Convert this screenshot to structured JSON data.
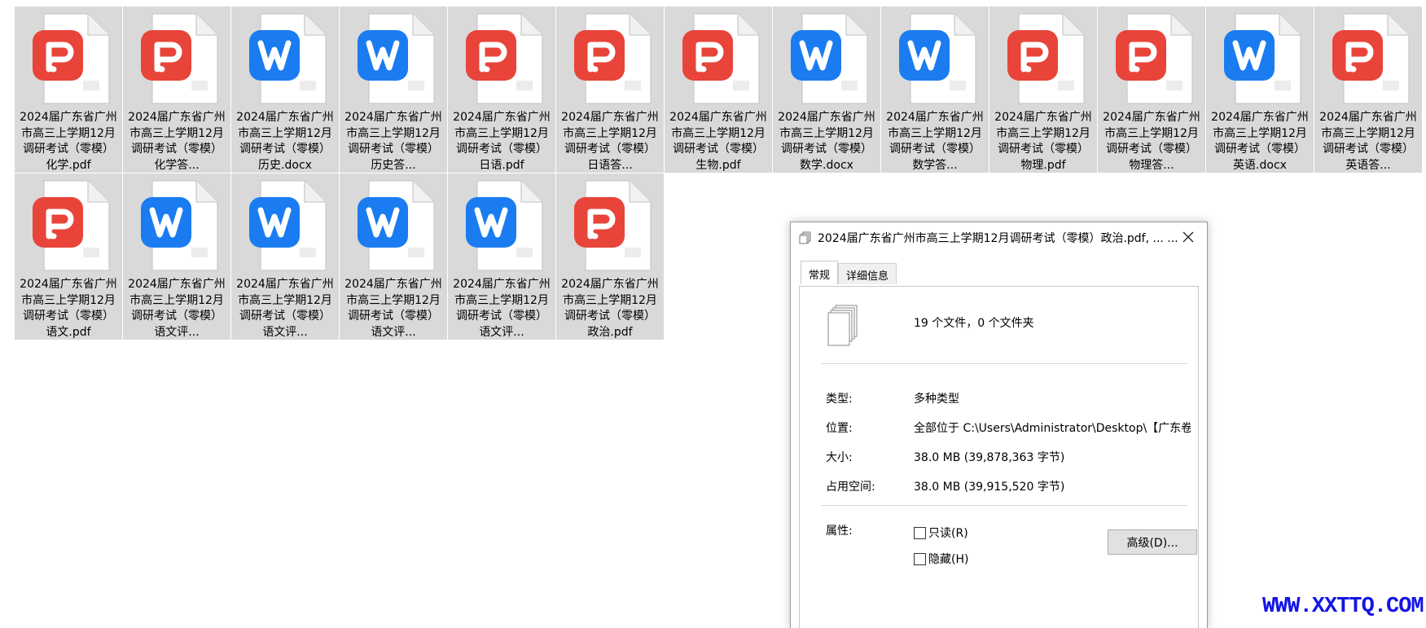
{
  "files": [
    {
      "name": "2024届广东省广州市高三上学期12月调研考试（零模）化学.pdf",
      "type": "pdf",
      "label": "2024届广东省广州市高三上学期12月调研考试（零模）化学.pdf"
    },
    {
      "name": "2024届广东省广州市高三上学期12月调研考试（零模）化学答...",
      "type": "pdf",
      "label": "2024届广东省广州市高三上学期12月调研考试（零模）化学答..."
    },
    {
      "name": "2024届广东省广州市高三上学期12月调研考试（零模）历史.docx",
      "type": "docx",
      "label": "2024届广东省广州市高三上学期12月调研考试（零模）历史.docx"
    },
    {
      "name": "2024届广东省广州市高三上学期12月调研考试（零模）历史答...",
      "type": "docx",
      "label": "2024届广东省广州市高三上学期12月调研考试（零模）历史答..."
    },
    {
      "name": "2024届广东省广州市高三上学期12月调研考试（零模）日语.pdf",
      "type": "pdf",
      "label": "2024届广东省广州市高三上学期12月调研考试（零模）日语.pdf"
    },
    {
      "name": "2024届广东省广州市高三上学期12月调研考试（零模）日语答...",
      "type": "pdf",
      "label": "2024届广东省广州市高三上学期12月调研考试（零模）日语答..."
    },
    {
      "name": "2024届广东省广州市高三上学期12月调研考试（零模）生物.pdf",
      "type": "pdf",
      "label": "2024届广东省广州市高三上学期12月调研考试（零模）生物.pdf"
    },
    {
      "name": "2024届广东省广州市高三上学期12月调研考试（零模）数学.docx",
      "type": "docx",
      "label": "2024届广东省广州市高三上学期12月调研考试（零模）数学.docx"
    },
    {
      "name": "2024届广东省广州市高三上学期12月调研考试（零模）数学答...",
      "type": "docx",
      "label": "2024届广东省广州市高三上学期12月调研考试（零模）数学答..."
    },
    {
      "name": "2024届广东省广州市高三上学期12月调研考试（零模）物理.pdf",
      "type": "pdf",
      "label": "2024届广东省广州市高三上学期12月调研考试（零模）物理.pdf"
    },
    {
      "name": "2024届广东省广州市高三上学期12月调研考试（零模）物理答...",
      "type": "pdf",
      "label": "2024届广东省广州市高三上学期12月调研考试（零模）物理答..."
    },
    {
      "name": "2024届广东省广州市高三上学期12月调研考试（零模）英语.docx",
      "type": "docx",
      "label": "2024届广东省广州市高三上学期12月调研考试（零模）英语.docx"
    },
    {
      "name": "2024届广东省广州市高三上学期12月调研考试（零模）英语答...",
      "type": "pdf",
      "label": "2024届广东省广州市高三上学期12月调研考试（零模）英语答..."
    },
    {
      "name": "2024届广东省广州市高三上学期12月调研考试（零模）语文.pdf",
      "type": "pdf",
      "label": "2024届广东省广州市高三上学期12月调研考试（零模）语文.pdf"
    },
    {
      "name": "2024届广东省广州市高三上学期12月调研考试（零模）语文评...",
      "type": "docx",
      "label": "2024届广东省广州市高三上学期12月调研考试（零模）语文评..."
    },
    {
      "name": "2024届广东省广州市高三上学期12月调研考试（零模）语文评...",
      "type": "docx",
      "label": "2024届广东省广州市高三上学期12月调研考试（零模）语文评..."
    },
    {
      "name": "2024届广东省广州市高三上学期12月调研考试（零模）语文评...",
      "type": "docx",
      "label": "2024届广东省广州市高三上学期12月调研考试（零模）语文评..."
    },
    {
      "name": "2024届广东省广州市高三上学期12月调研考试（零模）语文评...",
      "type": "docx",
      "label": "2024届广东省广州市高三上学期12月调研考试（零模）语文评..."
    },
    {
      "name": "2024届广东省广州市高三上学期12月调研考试（零模）政治.pdf",
      "type": "pdf",
      "label": "2024届广东省广州市高三上学期12月调研考试（零模）政治.pdf"
    }
  ],
  "icons": {
    "pdf": "pdf-file-icon",
    "docx": "word-file-icon",
    "pdf_color": "#e8443a",
    "docx_color": "#1a7cf0"
  },
  "dialog": {
    "title": "2024届广东省广州市高三上学期12月调研考试（零模）政治.pdf, ... ...",
    "tabs": [
      "常规",
      "详细信息"
    ],
    "summary": "19 个文件，0 个文件夹",
    "type_label": "类型:",
    "type_value": "多种类型",
    "location_label": "位置:",
    "location_value": "全部位于 C:\\Users\\Administrator\\Desktop\\【广东卷】",
    "size_label": "大小:",
    "size_value": "38.0 MB (39,878,363 字节)",
    "disk_label": "占用空间:",
    "disk_value": "38.0 MB (39,915,520 字节)",
    "attr_label": "属性:",
    "readonly_label": "只读(R)",
    "hidden_label": "隐藏(H)",
    "advanced_label": "高级(D)..."
  },
  "watermark": "WWW.XXTTQ.COM"
}
